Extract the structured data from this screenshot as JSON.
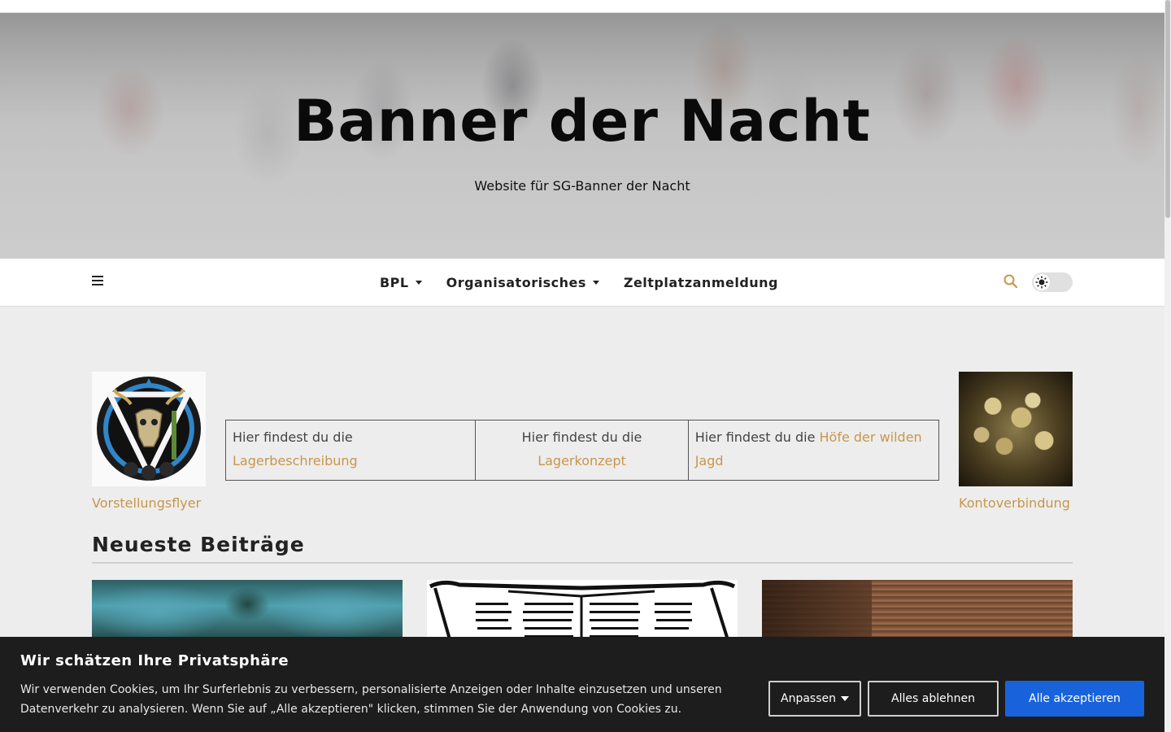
{
  "site": {
    "title": "Banner der Nacht",
    "subtitle": "Website für SG-Banner der Nacht"
  },
  "nav": {
    "menu_icon": "hamburger-icon",
    "items": [
      {
        "label": "BPL",
        "has_dropdown": true
      },
      {
        "label": "Organisatorisches",
        "has_dropdown": true
      },
      {
        "label": "Zeltplatzanmeldung",
        "has_dropdown": false
      }
    ],
    "search_icon": "search-icon",
    "theme_toggle_icon": "sun-icon"
  },
  "featured": {
    "left_caption": "Vorstellungsflyer",
    "right_caption": "Kontoverbindung",
    "table": [
      {
        "prefix": "Hier findest du die",
        "link": "Lagerbeschreibung"
      },
      {
        "prefix": "Hier findest du die",
        "link": "Lagerkonzept"
      },
      {
        "prefix": "Hier findest du die ",
        "link": "Höfe der wilden Jagd"
      }
    ]
  },
  "posts": {
    "heading": "Neueste Beiträge"
  },
  "cookie": {
    "title": "Wir schätzen Ihre Privatsphäre",
    "text": "Wir verwenden Cookies, um Ihr Surferlebnis zu verbessern, personalisierte Anzeigen oder Inhalte einzusetzen und unseren Datenverkehr zu analysieren. Wenn Sie auf „Alle akzeptieren\" klicken, stimmen Sie der Anwendung von Cookies zu.",
    "customize_label": "Anpassen",
    "reject_label": "Alles ablehnen",
    "accept_label": "Alle akzeptieren"
  },
  "colors": {
    "accent_link": "#c8964a",
    "cookie_bg": "#1d1d1d",
    "accept_button": "#1863dc"
  }
}
